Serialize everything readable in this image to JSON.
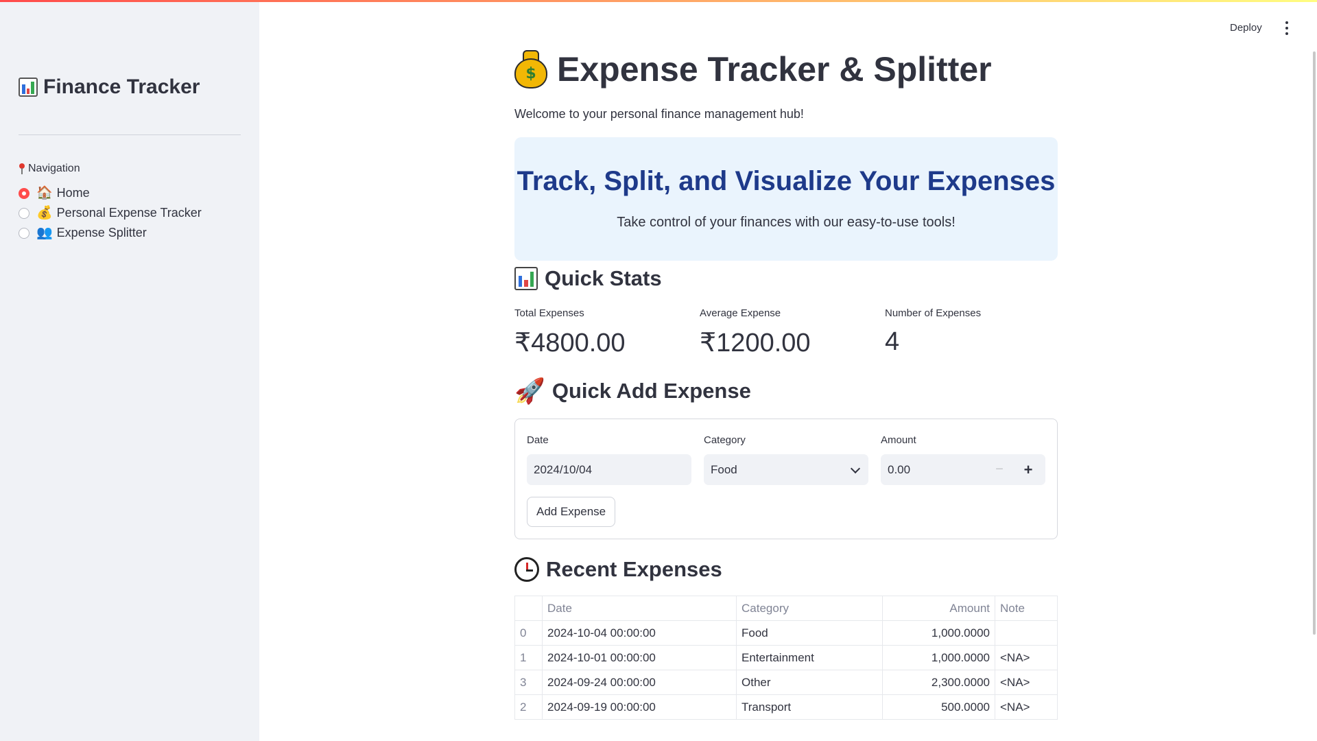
{
  "sidebar": {
    "title": "Finance Tracker",
    "nav_label": "Navigation",
    "items": [
      {
        "label": "Home",
        "icon": "🏠",
        "selected": true
      },
      {
        "label": "Personal Expense Tracker",
        "icon": "💰",
        "selected": false
      },
      {
        "label": "Expense Splitter",
        "icon": "👥",
        "selected": false
      }
    ]
  },
  "header": {
    "deploy_label": "Deploy"
  },
  "page": {
    "title": "Expense Tracker & Splitter",
    "welcome": "Welcome to your personal finance management hub!",
    "hero_title": "Track, Split, and Visualize Your Expenses",
    "hero_subtitle": "Take control of your finances with our easy-to-use tools!"
  },
  "quick_stats": {
    "heading": "Quick Stats",
    "metrics": [
      {
        "label": "Total Expenses",
        "value": "₹4800.00"
      },
      {
        "label": "Average Expense",
        "value": "₹1200.00"
      },
      {
        "label": "Number of Expenses",
        "value": "4"
      }
    ]
  },
  "quick_add": {
    "heading": "Quick Add Expense",
    "date_label": "Date",
    "date_value": "2024/10/04",
    "category_label": "Category",
    "category_value": "Food",
    "amount_label": "Amount",
    "amount_value": "0.00",
    "minus": "−",
    "plus": "+",
    "button_label": "Add Expense"
  },
  "recent": {
    "heading": "Recent Expenses",
    "columns": [
      "",
      "Date",
      "Category",
      "Amount",
      "Note"
    ],
    "rows": [
      {
        "index": "0",
        "date": "2024-10-04 00:00:00",
        "category": "Food",
        "amount": "1,000.0000",
        "note": ""
      },
      {
        "index": "1",
        "date": "2024-10-01 00:00:00",
        "category": "Entertainment",
        "amount": "1,000.0000",
        "note": "<NA>"
      },
      {
        "index": "3",
        "date": "2024-09-24 00:00:00",
        "category": "Other",
        "amount": "2,300.0000",
        "note": "<NA>"
      },
      {
        "index": "2",
        "date": "2024-09-19 00:00:00",
        "category": "Transport",
        "amount": "500.0000",
        "note": "<NA>"
      }
    ]
  },
  "colors": {
    "accent": "#ff4b4b",
    "hero_bg": "#eaf4fd",
    "hero_title": "#1e3a8a",
    "sidebar_bg": "#f0f2f6"
  }
}
